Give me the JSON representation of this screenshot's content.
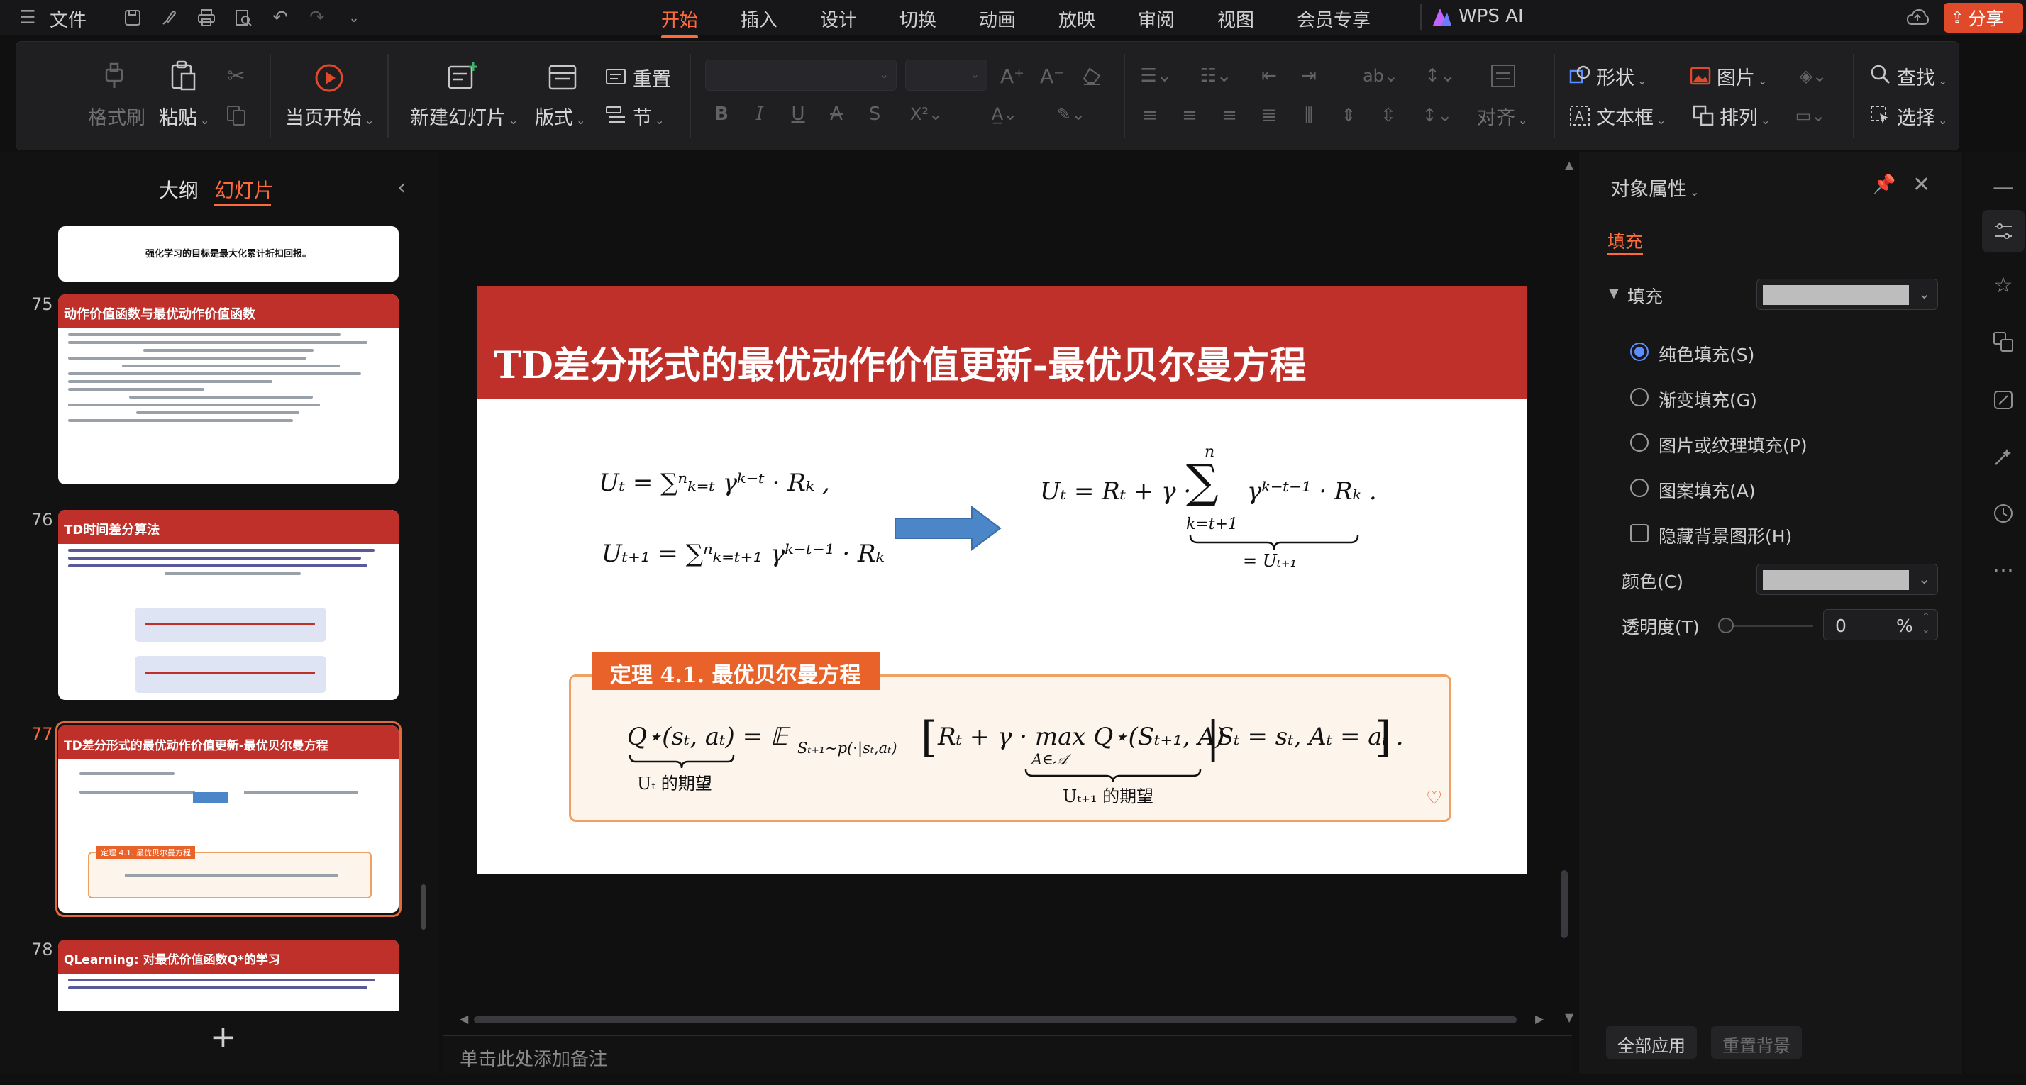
{
  "topbar": {
    "file_menu": "文件",
    "tabs": [
      {
        "label": "开始",
        "active": true
      },
      {
        "label": "插入"
      },
      {
        "label": "设计"
      },
      {
        "label": "切换"
      },
      {
        "label": "动画"
      },
      {
        "label": "放映"
      },
      {
        "label": "审阅"
      },
      {
        "label": "视图"
      },
      {
        "label": "会员专享"
      }
    ],
    "wps_ai": "WPS AI",
    "share": "分享"
  },
  "ribbon": {
    "format_painter": "格式刷",
    "paste": "粘贴",
    "start_from_current": "当页开始",
    "new_slide": "新建幻灯片",
    "layout": "版式",
    "reset": "重置",
    "section": "节",
    "align": "对齐",
    "shape": "形状",
    "picture": "图片",
    "textbox": "文本框",
    "arrange": "排列",
    "find": "查找",
    "select": "选择"
  },
  "left_panel": {
    "tab_outline": "大纲",
    "tab_slides": "幻灯片",
    "partial_slide_text": "强化学习的目标是最大化累计折扣回报。",
    "thumbnails": [
      {
        "num": "75",
        "title": "动作价值函数与最优动作价值函数"
      },
      {
        "num": "76",
        "title": "TD时间差分算法"
      },
      {
        "num": "77",
        "title": "TD差分形式的最优动作价值更新-最优贝尔曼方程",
        "theorem": "定理 4.1. 最优贝尔曼方程"
      },
      {
        "num": "78",
        "title": "QLearning:  对最优价值函数Q*的学习"
      }
    ],
    "add_slide": "+"
  },
  "slide": {
    "title": "TD差分形式的最优动作价值更新-最优贝尔曼方程",
    "theorem_label": "定理 4.1. 最优贝尔曼方程",
    "ut_expectation": "Uₜ 的期望",
    "ut1_expectation": "Uₜ₊₁ 的期望",
    "eq_left1": "Uₜ = ∑ⁿₖ₌ₜ γᵏ⁻ᵗ · Rₖ ,",
    "eq_left2": "Uₜ₊₁ = ∑ⁿₖ₌ₜ₊₁ γᵏ⁻ᵗ⁻¹ · Rₖ",
    "eq_right": "Uₜ  =  Rₜ + γ ·",
    "eq_right_sum": "γᵏ⁻ᵗ⁻¹ · Rₖ .",
    "eq_right_n": "n",
    "eq_right_lower": "k=t+1",
    "eq_right_brace": "= Uₜ₊₁",
    "bellman": "Q⋆(sₜ, aₜ)  =  𝔼",
    "bellman_sub": "Sₜ₊₁∼p(·|sₜ,aₜ)",
    "bellman_mid": "Rₜ + γ · max Q⋆(Sₜ₊₁, A)",
    "bellman_max_sub": "A∈𝒜",
    "bellman_cond": "Sₜ = sₜ, Aₜ = aₜ ."
  },
  "notes": {
    "placeholder": "单击此处添加备注"
  },
  "right_panel": {
    "title": "对象属性",
    "tab_fill": "填充",
    "section_fill": "填充",
    "options": [
      {
        "label": "纯色填充(S)",
        "type": "radio",
        "checked": true
      },
      {
        "label": "渐变填充(G)",
        "type": "radio"
      },
      {
        "label": "图片或纹理填充(P)",
        "type": "radio"
      },
      {
        "label": "图案填充(A)",
        "type": "radio"
      },
      {
        "label": "隐藏背景图形(H)",
        "type": "checkbox"
      }
    ],
    "color_label": "颜色(C)",
    "transparency_label": "透明度(T)",
    "transparency_value": "0",
    "transparency_unit": "%",
    "apply_all": "全部应用",
    "reset_bg": "重置背景",
    "swatch_color": "#bdbdbd"
  },
  "colors": {
    "accent": "#ff6a3c",
    "slide_header": "#c0302a",
    "theorem_label": "#e9622a",
    "arrow": "#4a86c8"
  }
}
